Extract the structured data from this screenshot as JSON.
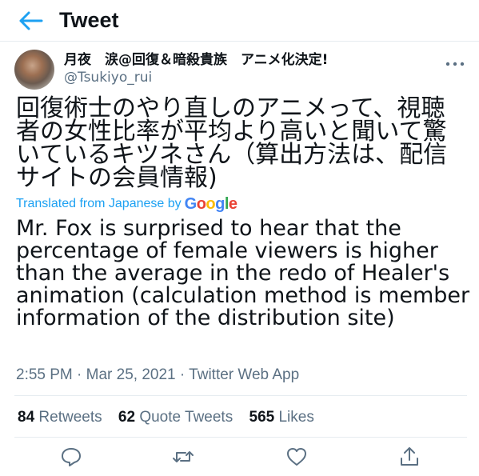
{
  "header": {
    "title": "Tweet"
  },
  "author": {
    "display_name": "月夜　涙@回復＆暗殺貴族　アニメ化決定!",
    "handle": "@Tsukiyo_rui"
  },
  "tweet": {
    "text": "回復術士のやり直しのアニメって、視聴者の女性比率が平均より高いと聞いて驚いているキツネさん（算出方法は、配信サイトの会員情報)",
    "translated_label": "Translated from Japanese by",
    "translator": "Google",
    "translation": "Mr. Fox is surprised to hear that the percentage of female viewers is higher than the average in the redo of Healer's animation (calculation method is member information of the distribution site)",
    "time": "2:55 PM",
    "date": "Mar 25, 2021",
    "source": "Twitter Web App",
    "sep": "·"
  },
  "stats": {
    "retweets_count": "84",
    "retweets_label": "Retweets",
    "quotes_count": "62",
    "quotes_label": "Quote Tweets",
    "likes_count": "565",
    "likes_label": "Likes"
  },
  "colors": {
    "accent": "#1da1f2",
    "muted": "#5b7083",
    "divider": "#e6ecf0"
  }
}
